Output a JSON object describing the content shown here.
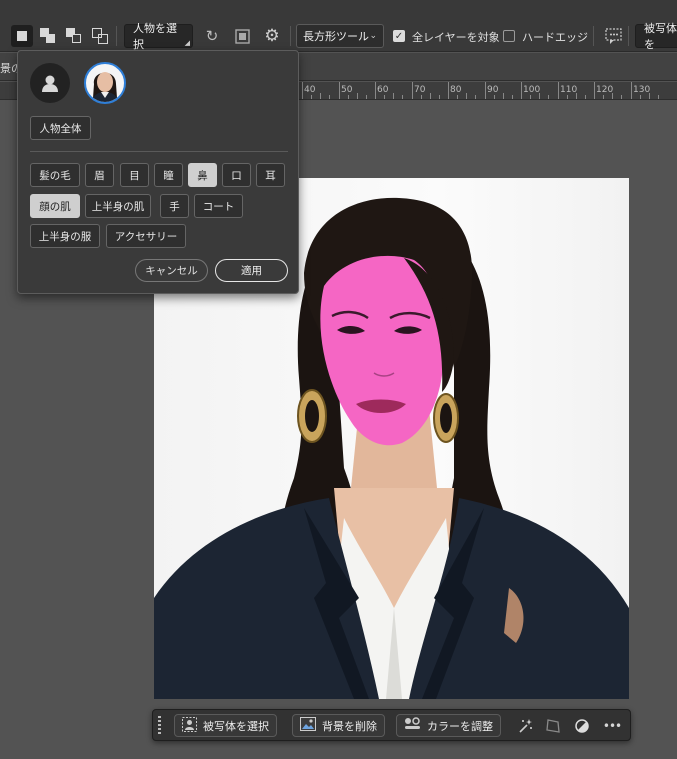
{
  "options_bar": {
    "select_subject_label": "人物を選択",
    "shape_mode": "長方形ツール",
    "all_layers_label": "全レイヤーを対象",
    "all_layers_checked": true,
    "hard_edge_label": "ハードエッジ",
    "hard_edge_checked": false,
    "select_subject_truncated": "被写体を"
  },
  "tab_strip": {
    "partial_tab_text": "景の"
  },
  "ruler": {
    "ticks": [
      "40",
      "50",
      "60",
      "70",
      "80",
      "90",
      "100",
      "110",
      "120",
      "130"
    ]
  },
  "popup": {
    "whole_person_label": "人物全体",
    "parts": [
      {
        "label": "髪の毛",
        "selected": false
      },
      {
        "label": "眉",
        "selected": false
      },
      {
        "label": "目",
        "selected": false
      },
      {
        "label": "瞳",
        "selected": false
      },
      {
        "label": "鼻",
        "selected": true
      },
      {
        "label": "口",
        "selected": false
      },
      {
        "label": "耳",
        "selected": false
      },
      {
        "label": "顔の肌",
        "selected": true
      },
      {
        "label": "上半身の肌",
        "selected": false
      },
      {
        "label": "手",
        "selected": false
      },
      {
        "label": "コート",
        "selected": false
      },
      {
        "label": "上半身の服",
        "selected": false
      },
      {
        "label": "アクセサリー",
        "selected": false
      }
    ],
    "cancel_label": "キャンセル",
    "apply_label": "適用"
  },
  "context_bar": {
    "select_subject": "被写体を選択",
    "remove_background": "背景を削除",
    "adjust_color": "カラーを調整",
    "more": "•••"
  },
  "colors": {
    "mask": "#f566c4",
    "accent_ring": "#2f7fd8"
  }
}
